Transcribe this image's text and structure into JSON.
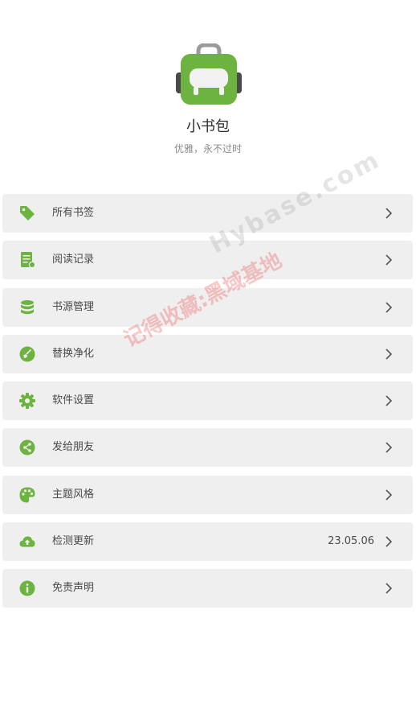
{
  "app": {
    "name": "小书包",
    "slogan": "优雅，永不过时"
  },
  "colors": {
    "accent": "#6db33f",
    "item_bg": "#efefef",
    "text": "#4a4a4a",
    "chevron": "#555555"
  },
  "menu": [
    {
      "label": "所有书签",
      "icon": "tag-icon",
      "value": ""
    },
    {
      "label": "阅读记录",
      "icon": "reading-record-icon",
      "value": ""
    },
    {
      "label": "书源管理",
      "icon": "database-icon",
      "value": ""
    },
    {
      "label": "替换净化",
      "icon": "clean-brush-icon",
      "value": ""
    },
    {
      "label": "软件设置",
      "icon": "gear-icon",
      "value": ""
    },
    {
      "label": "发给朋友",
      "icon": "share-icon",
      "value": ""
    },
    {
      "label": "主题风格",
      "icon": "palette-icon",
      "value": ""
    },
    {
      "label": "检测更新",
      "icon": "cloud-upload-icon",
      "value": "23.05.06"
    },
    {
      "label": "免责声明",
      "icon": "info-icon",
      "value": ""
    }
  ],
  "watermark": {
    "text_cn": "记得收藏:黑域基地",
    "text_en": "Hybase.com"
  }
}
